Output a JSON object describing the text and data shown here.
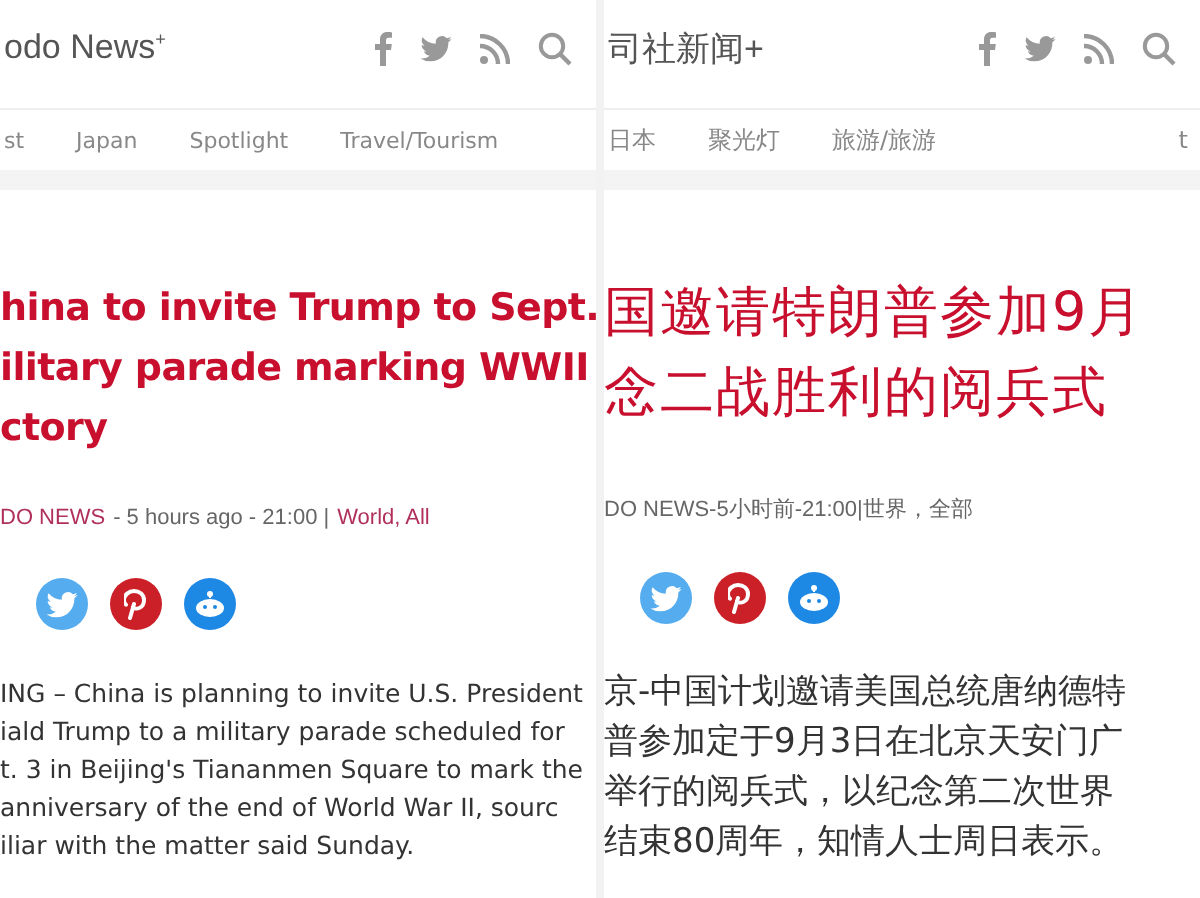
{
  "panels": [
    {
      "logo": "odo News$^{+}$",
      "nav": [
        "st",
        "Japan",
        "Spotlight",
        "Travel/Tourism"
      ],
      "headline": [
        "hina to invite Trump to Sept.",
        "ilitary parade marking WWII",
        "ctory"
      ],
      "kind": "english",
      "meta": [
        {
          "kind": "link",
          "text": "DO NEWS"
        },
        {
          "kind": "plain",
          "text": "- 5 hours ago - 21:00 |"
        },
        {
          "kind": "link",
          "text": "World, All"
        }
      ],
      "body": [
        "ING – China is planning to invite U.S. President",
        "iald Trump to a military parade scheduled for",
        "t. 3 in Beijing's Tiananmen Square to mark the",
        "anniversary of the end of World War II, sourc",
        "iliar with the matter said Sunday."
      ]
    },
    {
      "logo": "司社新闻+",
      "nav": [
        "日本",
        "聚光灯",
        "旅游/旅游",
        "t"
      ],
      "headline": [
        "国邀请特朗普参加9月",
        "念二战胜利的阅兵式"
      ],
      "kind": "chinese",
      "meta": [
        {
          "kind": "plain",
          "text": "DO NEWS-5小时前-21:00|世界，全部"
        }
      ],
      "body": [
        "京-中国计划邀请美国总统唐纳德特",
        "普参加定于9月3日在北京天安门广",
        "举行的阅兵式，以纪念第二次世界",
        "结束80周年，知情人士周日表示。"
      ]
    }
  ]
}
